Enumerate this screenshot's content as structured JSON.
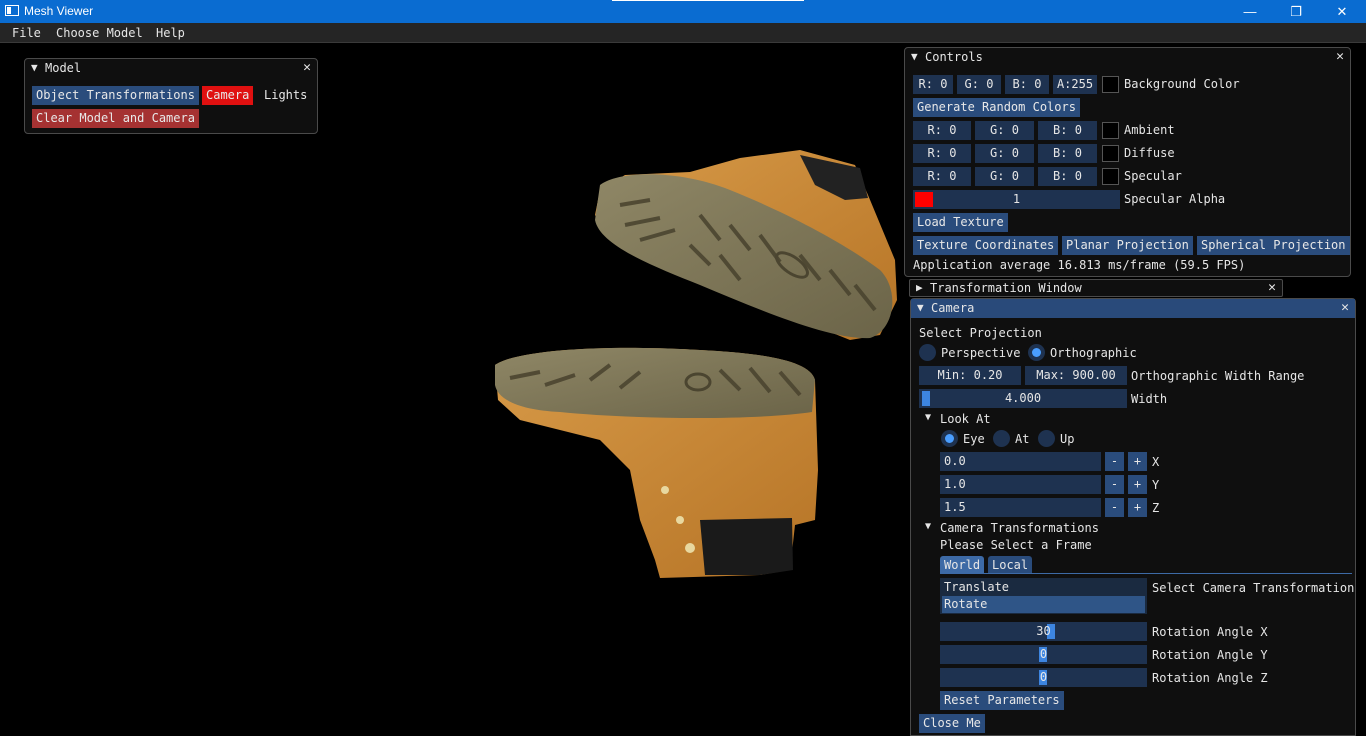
{
  "window": {
    "title": "Mesh Viewer",
    "minimize": "—",
    "restore": "❐",
    "close": "✕"
  },
  "menu": [
    "File",
    "Choose Model",
    "Help"
  ],
  "model_panel": {
    "title": "Model",
    "close": "✕",
    "object_transformations": "Object Transformations",
    "camera": "Camera",
    "lights": "Lights",
    "clear": "Clear Model and Camera"
  },
  "controls": {
    "title": "Controls",
    "close": "✕",
    "bg": {
      "r": "R:  0",
      "g": "G:  0",
      "b": "B:  0",
      "a": "A:255",
      "label": "Background Color"
    },
    "generate": "Generate Random Colors",
    "ambient": {
      "r": "R:  0",
      "g": "G:  0",
      "b": "B:  0",
      "label": "Ambient"
    },
    "diffuse": {
      "r": "R:  0",
      "g": "G:  0",
      "b": "B:  0",
      "label": "Diffuse"
    },
    "specular": {
      "r": "R:  0",
      "g": "G:  0",
      "b": "B:  0",
      "label": "Specular"
    },
    "specular_alpha": {
      "value": "1",
      "label": "Specular Alpha",
      "swatch_color": "#ff0000"
    },
    "load_texture": "Load Texture",
    "texture_coords": "Texture Coordinates",
    "planar": "Planar Projection",
    "spherical": "Spherical Projection",
    "fps": "Application average 16.813 ms/frame (59.5 FPS)"
  },
  "transformation_window": {
    "title": "Transformation Window",
    "close": "✕"
  },
  "camera_panel": {
    "title": "Camera",
    "close": "✕",
    "select_projection": "Select Projection",
    "perspective": "Perspective",
    "orthographic": "Orthographic",
    "min": "Min: 0.20",
    "max": "Max: 900.00",
    "range_label": "Orthographic Width Range",
    "width_value": "4.000",
    "width_label": "Width",
    "look_at": "Look At",
    "eye": "Eye",
    "at": "At",
    "up": "Up",
    "x_value": "0.0",
    "y_value": "1.0",
    "z_value": "1.5",
    "x_label": "X",
    "y_label": "Y",
    "z_label": "Z",
    "minus": "-",
    "plus": "+",
    "cam_transforms": "Camera Transformations",
    "select_frame": "Please Select a Frame",
    "world": "World",
    "local": "Local",
    "translate": "Translate",
    "rotate": "Rotate",
    "select_cam_transform": "Select Camera Transformation",
    "rot_x": {
      "value": "30",
      "label": "Rotation Angle X"
    },
    "rot_y": {
      "value": "0",
      "label": "Rotation Angle Y"
    },
    "rot_z": {
      "value": "0",
      "label": "Rotation Angle Z"
    },
    "reset": "Reset Parameters",
    "close_me": "Close Me"
  },
  "colors": {
    "titlebar": "#0a6cd1",
    "accent": "#2a4c7c",
    "red": "#e01010",
    "dark_red": "#a53232",
    "boot": "#c98a3a"
  }
}
